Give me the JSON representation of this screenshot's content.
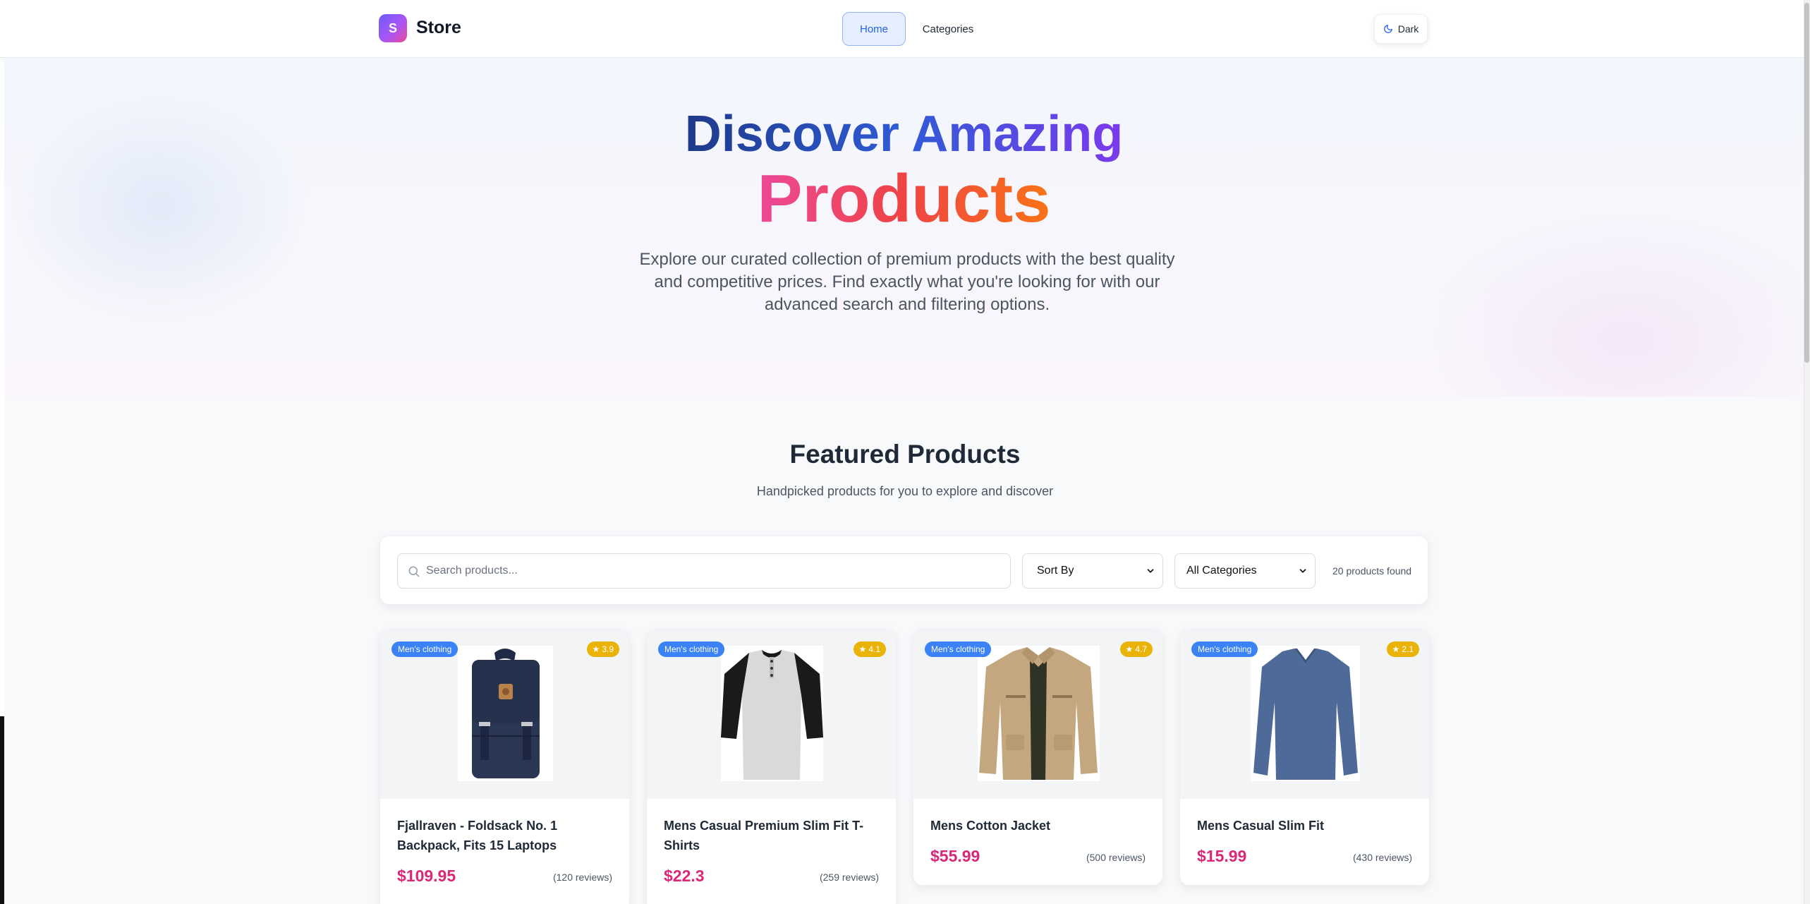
{
  "header": {
    "logo_letter": "S",
    "logo_text": "Store",
    "nav": {
      "home": "Home",
      "categories": "Categories"
    },
    "theme_toggle": "Dark"
  },
  "hero": {
    "title_line1": "Discover Amazing",
    "title_line2": "Products",
    "subtitle": "Explore our curated collection of premium products with the best quality and competitive prices. Find exactly what you're looking for with our advanced search and filtering options."
  },
  "featured": {
    "title": "Featured Products",
    "subtitle": "Handpicked products for you to explore and discover"
  },
  "filters": {
    "search_placeholder": "Search products...",
    "sort_value": "Sort By",
    "category_value": "All Categories",
    "count_text": "20 products found"
  },
  "products": [
    {
      "category": "Men's clothing",
      "rating": "3.9",
      "name": "Fjallraven - Foldsack No. 1 Backpack, Fits 15 Laptops",
      "price": "$109.95",
      "reviews": "(120 reviews)"
    },
    {
      "category": "Men's clothing",
      "rating": "4.1",
      "name": "Mens Casual Premium Slim Fit T-Shirts",
      "price": "$22.3",
      "reviews": "(259 reviews)"
    },
    {
      "category": "Men's clothing",
      "rating": "4.7",
      "name": "Mens Cotton Jacket",
      "price": "$55.99",
      "reviews": "(500 reviews)"
    },
    {
      "category": "Men's clothing",
      "rating": "2.1",
      "name": "Mens Casual Slim Fit",
      "price": "$15.99",
      "reviews": "(430 reviews)"
    }
  ],
  "colors": {
    "accent": "#2563eb",
    "price": "#db2777",
    "category_badge": "#3b82f6",
    "rating_badge": "#eab308"
  }
}
